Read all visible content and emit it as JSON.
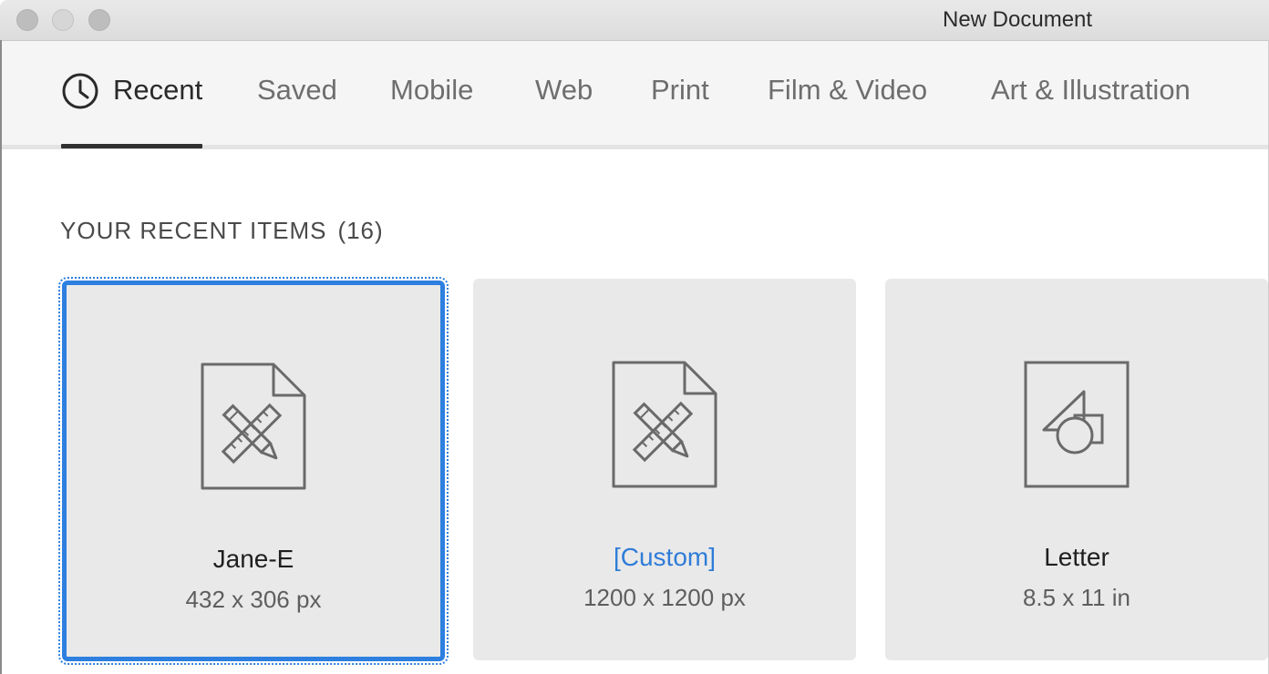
{
  "window": {
    "title": "New Document"
  },
  "tabs": [
    {
      "label": "Recent",
      "active": true,
      "icon": "clock-icon"
    },
    {
      "label": "Saved",
      "active": false
    },
    {
      "label": "Mobile",
      "active": false
    },
    {
      "label": "Web",
      "active": false
    },
    {
      "label": "Print",
      "active": false
    },
    {
      "label": "Film & Video",
      "active": false
    },
    {
      "label": "Art & Illustration",
      "active": false
    }
  ],
  "recent": {
    "heading": "YOUR RECENT ITEMS",
    "count": "(16)",
    "items": [
      {
        "name": "Jane-E",
        "size": "432 x 306 px",
        "icon": "ruler-pencil-document-icon",
        "selected": true
      },
      {
        "name": "[Custom]",
        "size": "1200 x 1200 px",
        "icon": "ruler-pencil-document-icon",
        "selected": false
      },
      {
        "name": "Letter",
        "size": "8.5 x 11 in",
        "icon": "shapes-page-icon",
        "selected": false
      }
    ]
  },
  "colors": {
    "accent": "#2d7fe0",
    "link": "#2f7cd8",
    "card_bg": "#e9e9e9",
    "tabbar_bg": "#f5f5f5"
  }
}
